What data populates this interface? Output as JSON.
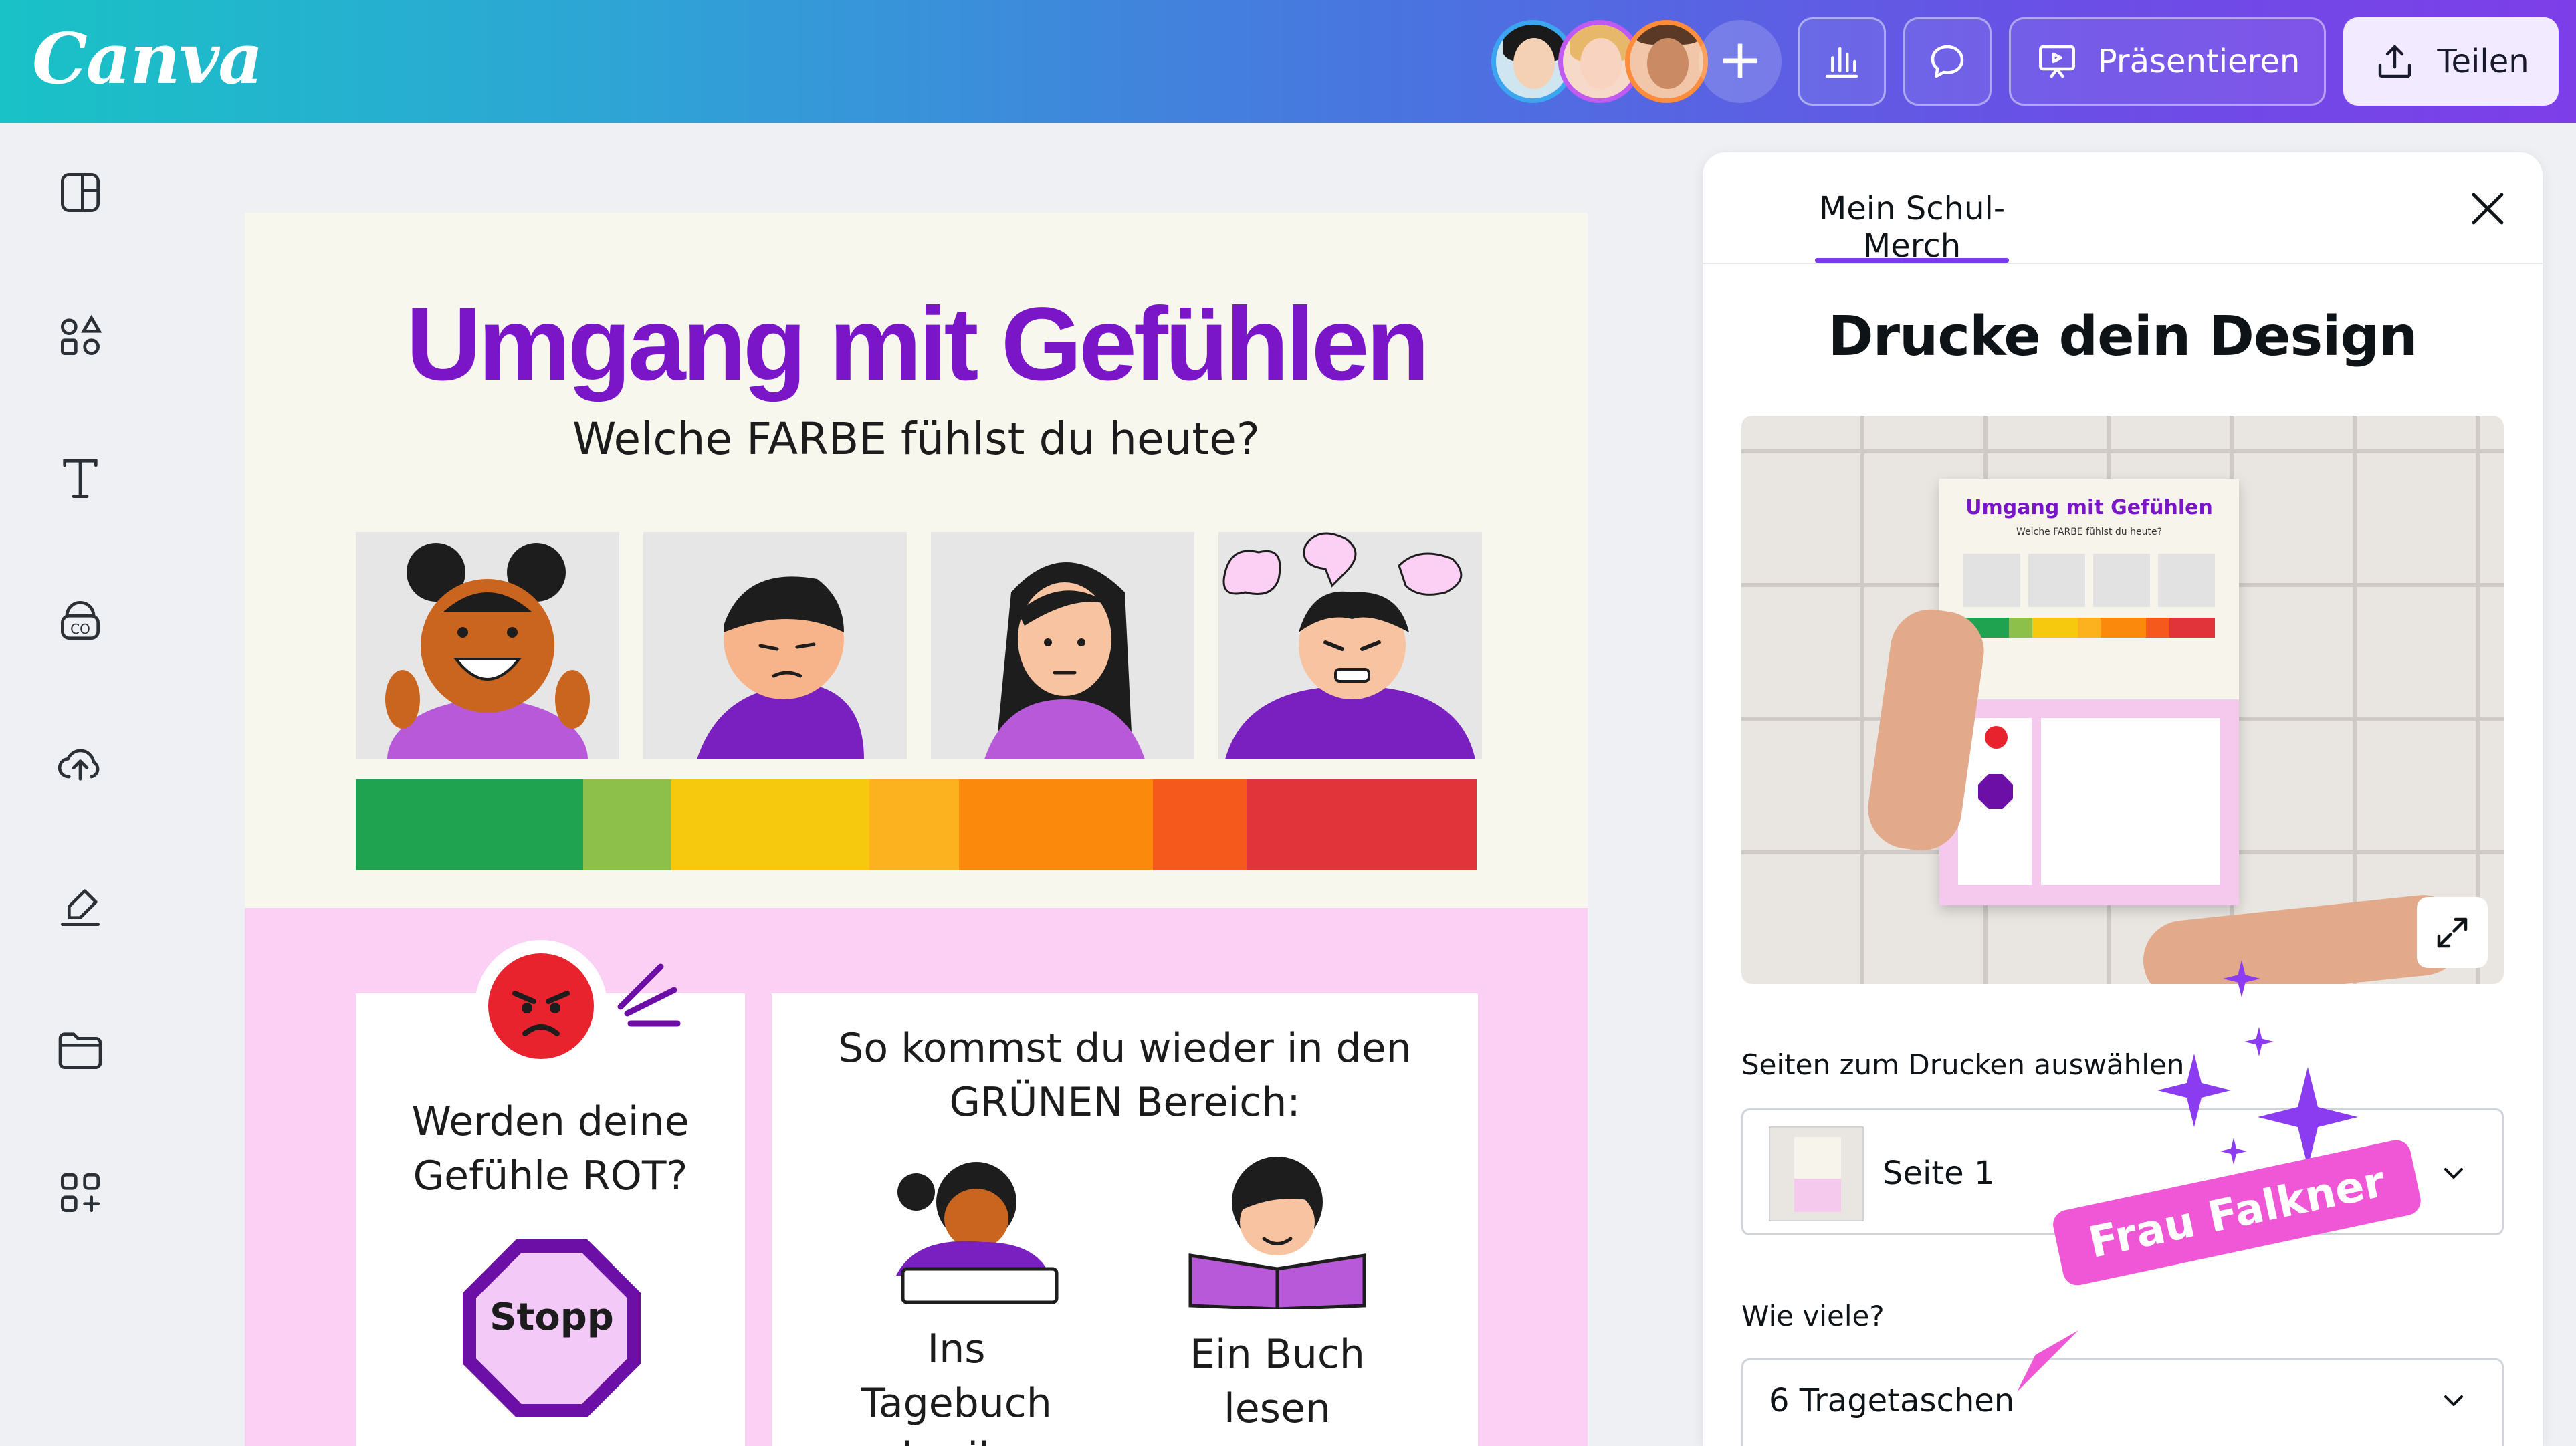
{
  "app": {
    "logo": "Canva"
  },
  "topbar": {
    "avatars": [
      "Collaborator 1",
      "Collaborator 2",
      "Collaborator 3"
    ],
    "add_label": "+",
    "present_label": "Präsentieren",
    "share_label": "Teilen",
    "colors": {
      "gradient_start": "#19c2c6",
      "gradient_end": "#7d3ee8",
      "share_bg": "#f2ebff"
    }
  },
  "sidebar": {
    "items": [
      "layout-icon",
      "elements-icon",
      "text-icon",
      "brand-icon",
      "uploads-icon",
      "draw-icon",
      "projects-icon",
      "apps-icon"
    ]
  },
  "design": {
    "title": "Umgang mit Gefühlen",
    "subtitle": "Welche FARBE fühlst du heute?",
    "title_color": "#7a16c8",
    "color_scale": [
      "#1fa350",
      "#8cc04a",
      "#f7c90e",
      "#fbb21e",
      "#fb8a0c",
      "#f55a1c",
      "#e1333a"
    ],
    "card1_text": "Werden deine Gefühle ROT?",
    "stop_label": "Stopp",
    "card2_heading": "So kommst du wieder in den GRÜNEN Bereich:",
    "strategies": [
      {
        "label": "Ins Tagebuch schreiben"
      },
      {
        "label": "Ein Buch lesen"
      }
    ]
  },
  "panel": {
    "tab_label": "Mein Schul-Merch",
    "heading": "Drucke dein Design",
    "preview": {
      "poster_title": "Umgang mit Gefühlen",
      "poster_subtitle": "Welche FARBE fühlst du heute?"
    },
    "pages_label": "Seiten zum Drucken auswählen",
    "pages_value": "Seite 1",
    "quantity_label": "Wie viele?",
    "quantity_value": "6 Tragetaschen",
    "accent_color": "#7c3aed"
  },
  "overlay": {
    "cursor_name": "Frau Falkner",
    "cursor_color": "#f057d6"
  }
}
